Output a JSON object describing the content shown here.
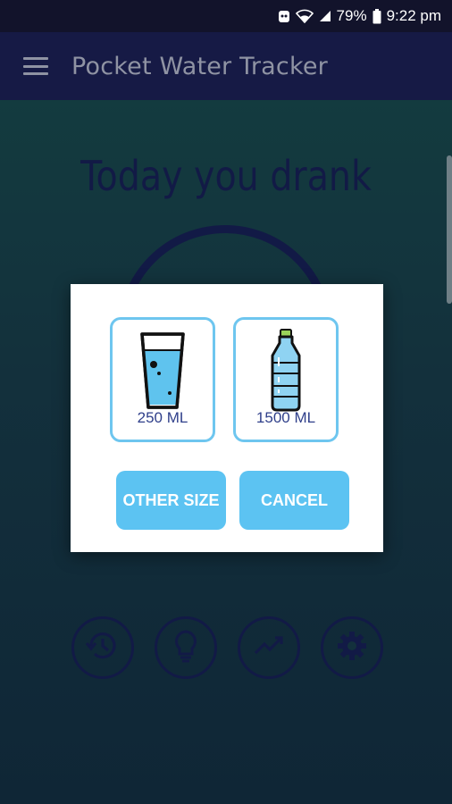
{
  "status_bar": {
    "battery": "79%",
    "time": "9:22 pm",
    "icons": [
      "notification-icon",
      "wifi-icon",
      "signal-icon",
      "battery-icon"
    ]
  },
  "app_bar": {
    "title": "Pocket Water Tracker",
    "menu_icon": "hamburger-menu-icon"
  },
  "main": {
    "heading": "Today you drank"
  },
  "bottom_nav": {
    "items": [
      {
        "icon": "history-icon"
      },
      {
        "icon": "lightbulb-icon"
      },
      {
        "icon": "chart-trend-icon"
      },
      {
        "icon": "gear-icon"
      }
    ]
  },
  "dialog": {
    "options": [
      {
        "label": "250 ML",
        "icon": "glass-icon"
      },
      {
        "label": "1500 ML",
        "icon": "bottle-icon"
      }
    ],
    "other_size_label": "OTHER SIZE",
    "cancel_label": "CANCEL"
  },
  "colors": {
    "status_bar": "#12132b",
    "app_bar": "#161a45",
    "accent": "#5cc3f2",
    "card_border": "#6ec6ef",
    "dark_navy": "#121a46"
  }
}
